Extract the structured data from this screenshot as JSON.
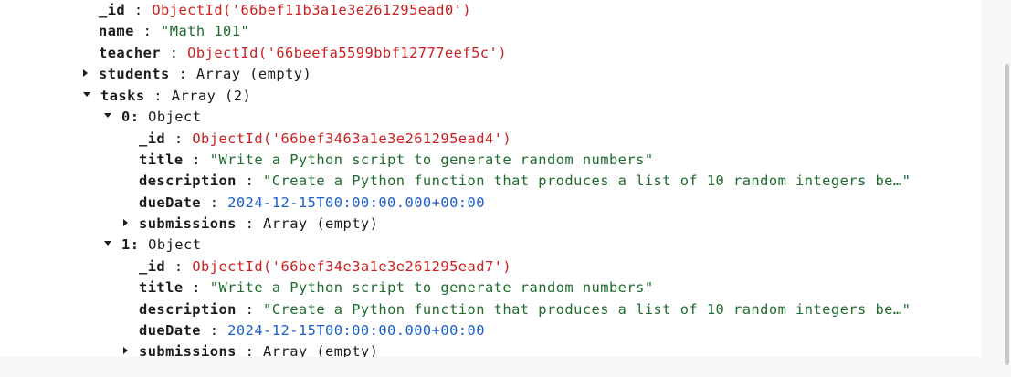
{
  "course": {
    "id_key": "_id",
    "id_value": "ObjectId('66bef11b3a1e3e261295ead0')",
    "name_key": "name",
    "name_value": "\"Math 101\"",
    "teacher_key": "teacher",
    "teacher_value": "ObjectId('66beefa5599bbf12777eef5c')",
    "students_key": "students",
    "students_value": "Array (empty)",
    "tasks_key": "tasks",
    "tasks_value": "Array (2)"
  },
  "tasks": [
    {
      "index_label": "0:",
      "type_label": "Object",
      "id_key": "_id",
      "id_value": "ObjectId('66bef3463a1e3e261295ead4')",
      "title_key": "title",
      "title_value": "\"Write a Python script to generate random numbers\"",
      "description_key": "description",
      "description_value": "\"Create a Python function that produces a list of 10 random integers be…\"",
      "dueDate_key": "dueDate",
      "dueDate_value": "2024-12-15T00:00:00.000+00:00",
      "submissions_key": "submissions",
      "submissions_value": "Array (empty)"
    },
    {
      "index_label": "1:",
      "type_label": "Object",
      "id_key": "_id",
      "id_value": "ObjectId('66bef34e3a1e3e261295ead7')",
      "title_key": "title",
      "title_value": "\"Write a Python script to generate random numbers\"",
      "description_key": "description",
      "description_value": "\"Create a Python function that produces a list of 10 random integers be…\"",
      "dueDate_key": "dueDate",
      "dueDate_value": "2024-12-15T00:00:00.000+00:00",
      "submissions_key": "submissions",
      "submissions_value": "Array (empty)"
    }
  ],
  "separator": " : ",
  "icons": {
    "collapsed": "caret-right-icon",
    "expanded": "caret-down-icon"
  }
}
